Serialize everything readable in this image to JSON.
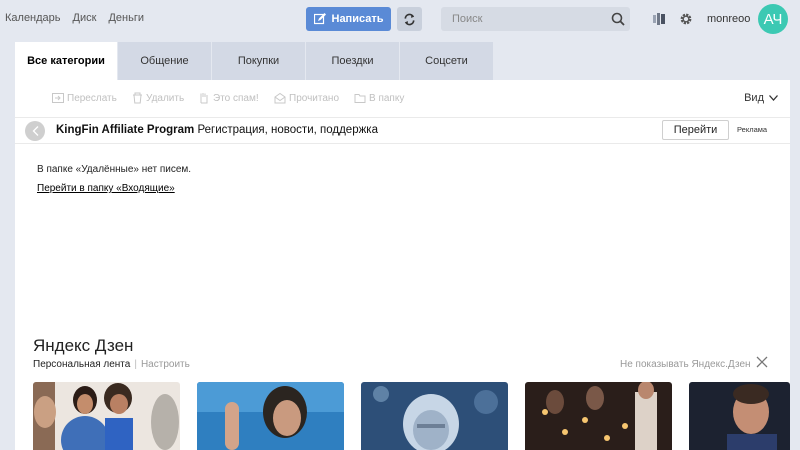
{
  "topbar": {
    "links": [
      "Календарь",
      "Диск",
      "Деньги"
    ],
    "compose_label": "Написать",
    "search_placeholder": "Поиск",
    "username": "monreoo",
    "avatar_initials": "АЧ"
  },
  "tabs": [
    "Все категории",
    "Общение",
    "Покупки",
    "Поездки",
    "Соцсети"
  ],
  "toolbar": {
    "forward": "Переслать",
    "delete": "Удалить",
    "spam": "Это спам!",
    "read": "Прочитано",
    "to_folder": "В папку",
    "view": "Вид"
  },
  "ad": {
    "title": "KingFin Affiliate Program",
    "description": "Регистрация, новости, поддержка",
    "button": "Перейти",
    "label": "Реклама"
  },
  "message": {
    "empty": "В папке «Удалённые» нет писем.",
    "link": "Перейти в папку «Входящие»"
  },
  "zen": {
    "title": "Яндекс Дзен",
    "feed": "Персональная лента",
    "configure": "Настроить",
    "hide": "Не показывать Яндекс.Дзен"
  },
  "colors": {
    "background": "#e4e8f0",
    "compose": "#5a8ad6",
    "avatar": "#3cc9b3"
  }
}
